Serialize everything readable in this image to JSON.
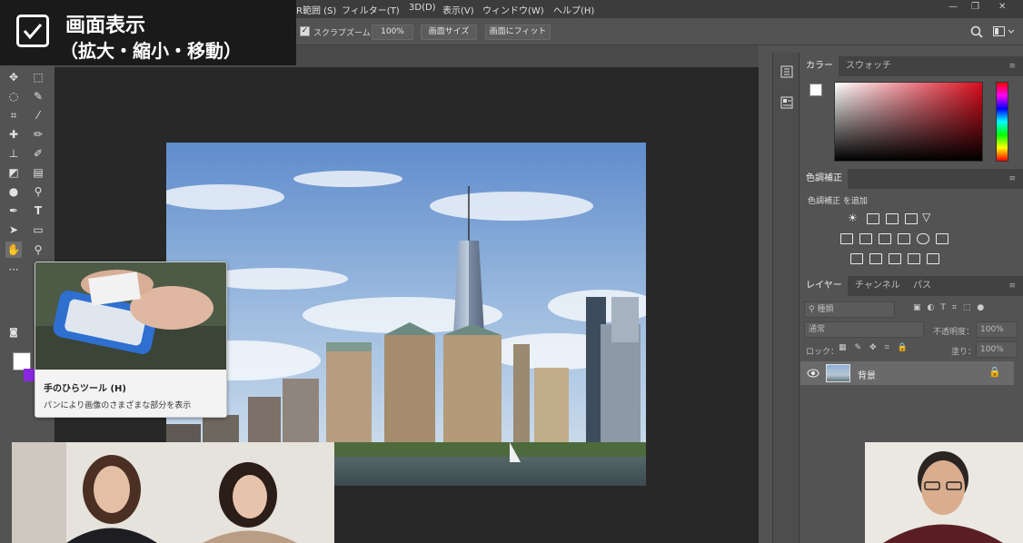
{
  "menubar": {
    "items": [
      "R範囲 (S)",
      "フィルター(T)",
      "3D(D)",
      "表示(V)",
      "ウィンドウ(W)",
      "ヘルプ(H)"
    ],
    "window_controls": [
      "—",
      "❐",
      "✕"
    ]
  },
  "options_bar": {
    "scrubby_zoom_label": "スクラブズーム",
    "zoom_value": "100%",
    "fit_screen_size_label": "画面サイズ",
    "fit_screen_label": "画面にフィット"
  },
  "title_overlay": {
    "line1": "画面表示",
    "line2": "（拡大・縮小・移動）"
  },
  "tooltip": {
    "title": "手のひらツール (H)",
    "description": "パンにより画像のさまざまな部分を表示"
  },
  "panels": {
    "color": {
      "tabs": [
        "カラー",
        "スウォッチ"
      ]
    },
    "adjustments": {
      "tab": "色調補正",
      "add_label": "色調補正 を追加"
    },
    "layers": {
      "tabs": [
        "レイヤー",
        "チャンネル",
        "パス"
      ],
      "kind_filter": "種類",
      "blend_mode": "通常",
      "opacity_label": "不透明度：",
      "opacity_value": "100%",
      "lock_label": "ロック：",
      "fill_label": "塗り：",
      "fill_value": "100%",
      "layer_name": "背景"
    }
  },
  "colors": {
    "foreground": "#ffffff",
    "background": "#8a28e0",
    "accent_red": "#d90d1d"
  }
}
